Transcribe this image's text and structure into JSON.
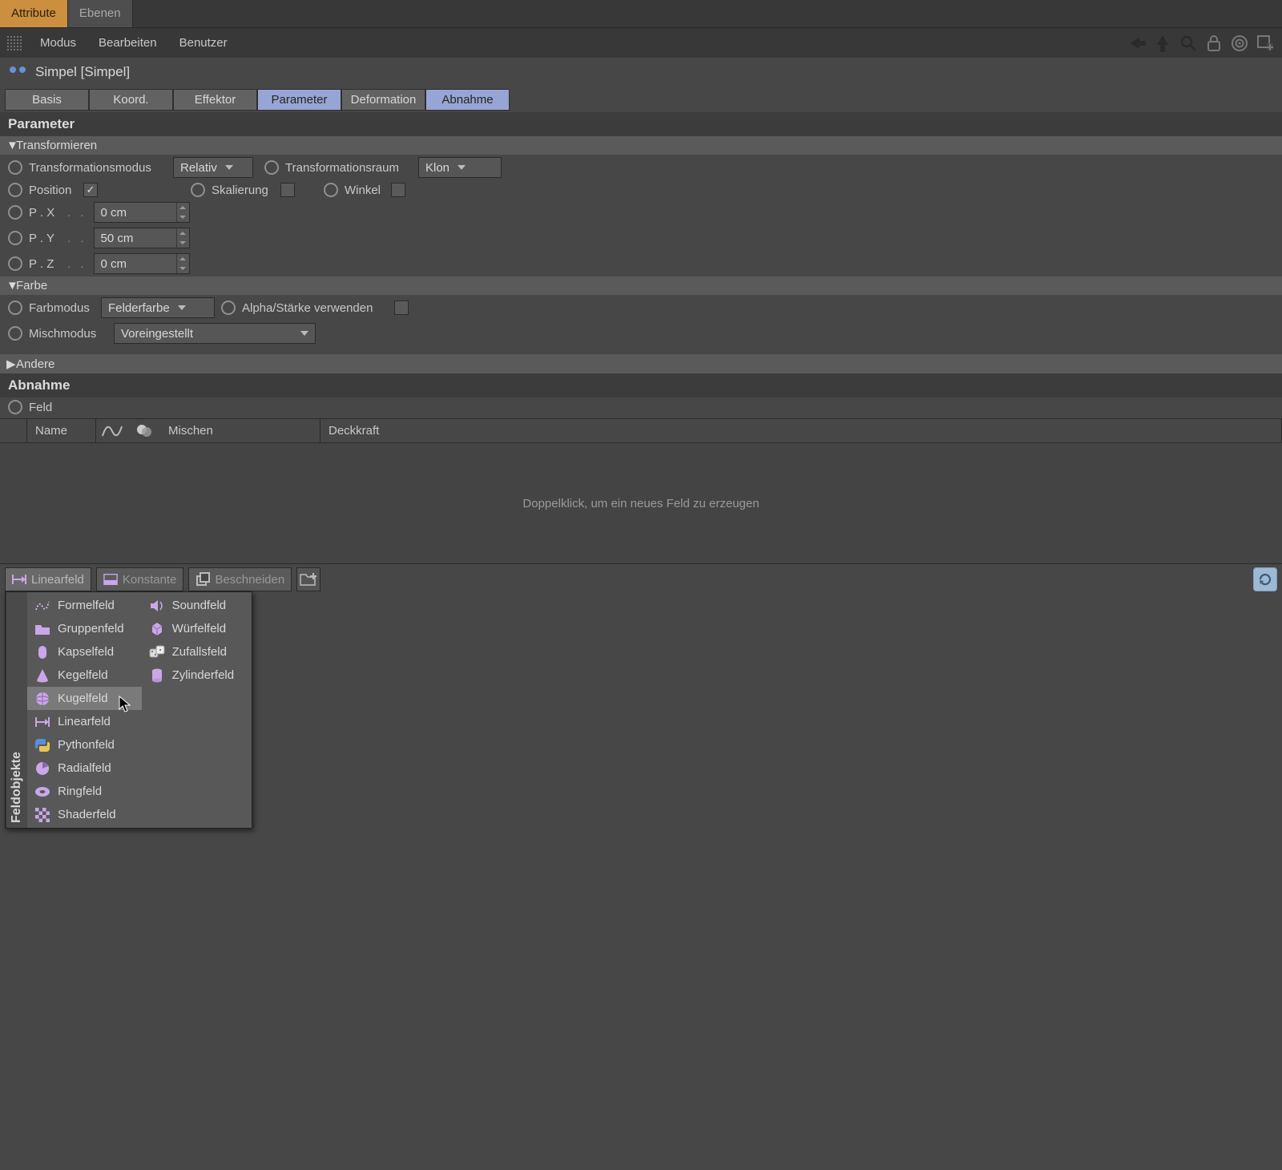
{
  "top_tabs": {
    "attribute": "Attribute",
    "ebenen": "Ebenen"
  },
  "menubar": {
    "modus": "Modus",
    "bearbeiten": "Bearbeiten",
    "benutzer": "Benutzer"
  },
  "object": {
    "name": "Simpel [Simpel]"
  },
  "section_tabs": {
    "basis": "Basis",
    "koord": "Koord.",
    "effektor": "Effektor",
    "parameter": "Parameter",
    "deformation": "Deformation",
    "abnahme": "Abnahme"
  },
  "headings": {
    "parameter": "Parameter",
    "abnahme": "Abnahme"
  },
  "groups": {
    "transformieren": "Transformieren",
    "farbe": "Farbe",
    "andere": "Andere"
  },
  "transform": {
    "transformationsmodus": "Transformationsmodus",
    "relativ": "Relativ",
    "transformationsraum": "Transformationsraum",
    "klon": "Klon",
    "position": "Position",
    "skalierung": "Skalierung",
    "winkel": "Winkel",
    "px": "P . X",
    "py": "P . Y",
    "pz": "P . Z",
    "px_val": "0 cm",
    "py_val": "50 cm",
    "pz_val": "0 cm"
  },
  "farbe": {
    "farbmodus": "Farbmodus",
    "felderfarbe": "Felderfarbe",
    "alpha": "Alpha/Stärke verwenden",
    "mischmodus": "Mischmodus",
    "voreingestellt": "Voreingestellt"
  },
  "abnahme": {
    "feld": "Feld"
  },
  "table": {
    "name": "Name",
    "mischen": "Mischen",
    "deckkraft": "Deckkraft",
    "empty": "Doppelklick, um ein neues Feld zu erzeugen"
  },
  "bottombar": {
    "linearfeld": "Linearfeld",
    "konstante": "Konstante",
    "beschneiden": "Beschneiden"
  },
  "popup": {
    "vlabel": "Feldobjekte",
    "col1": [
      "Formelfeld",
      "Gruppenfeld",
      "Kapselfeld",
      "Kegelfeld",
      "Kugelfeld",
      "Linearfeld",
      "Pythonfeld",
      "Radialfeld",
      "Ringfeld",
      "Shaderfeld"
    ],
    "col2": [
      "Soundfeld",
      "Würfelfeld",
      "Zufallsfeld",
      "Zylinderfeld"
    ]
  }
}
